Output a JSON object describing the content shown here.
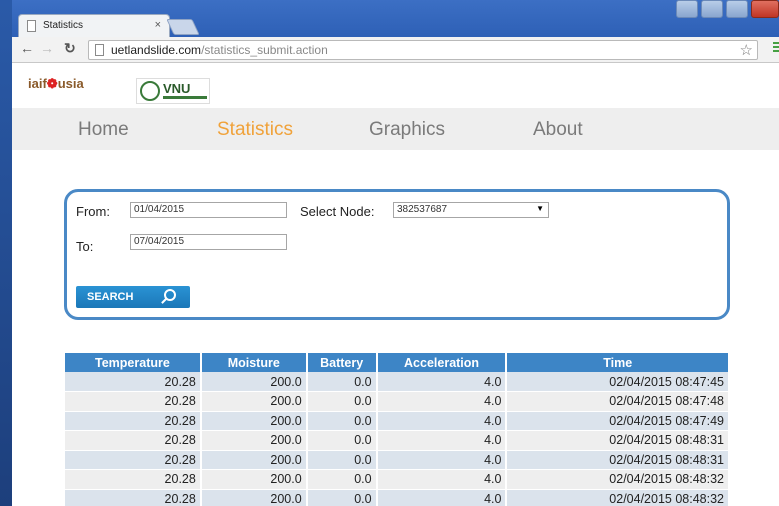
{
  "browser": {
    "tab_title": "Statistics",
    "tab_close": "×",
    "url_host": "uetlandslide.com",
    "url_path": "/statistics_submit.action"
  },
  "site": {
    "logo_text_left": "iaif",
    "logo_text_right": "usia",
    "vnu_text": "VNU"
  },
  "nav": {
    "items": [
      {
        "label": "Home"
      },
      {
        "label": "Statistics"
      },
      {
        "label": "Graphics"
      },
      {
        "label": "About"
      }
    ],
    "active": "Statistics"
  },
  "search": {
    "from_label": "From:",
    "from_value": "01/04/2015",
    "to_label": "To:",
    "to_value": "07/04/2015",
    "node_label": "Select Node:",
    "node_value": "382537687",
    "button_label": "SEARCH"
  },
  "table": {
    "headers": [
      "Temperature",
      "Moisture",
      "Battery",
      "Acceleration",
      "Time"
    ],
    "rows": [
      [
        "20.28",
        "200.0",
        "0.0",
        "4.0",
        "02/04/2015 08:47:45"
      ],
      [
        "20.28",
        "200.0",
        "0.0",
        "4.0",
        "02/04/2015 08:47:48"
      ],
      [
        "20.28",
        "200.0",
        "0.0",
        "4.0",
        "02/04/2015 08:47:49"
      ],
      [
        "20.28",
        "200.0",
        "0.0",
        "4.0",
        "02/04/2015 08:48:31"
      ],
      [
        "20.28",
        "200.0",
        "0.0",
        "4.0",
        "02/04/2015 08:48:31"
      ],
      [
        "20.28",
        "200.0",
        "0.0",
        "4.0",
        "02/04/2015 08:48:32"
      ],
      [
        "20.28",
        "200.0",
        "0.0",
        "4.0",
        "02/04/2015 08:48:32"
      ]
    ]
  },
  "colors": {
    "accent": "#3d85c6",
    "nav_active": "#f0a23a",
    "panel_border": "#4a89c6"
  }
}
